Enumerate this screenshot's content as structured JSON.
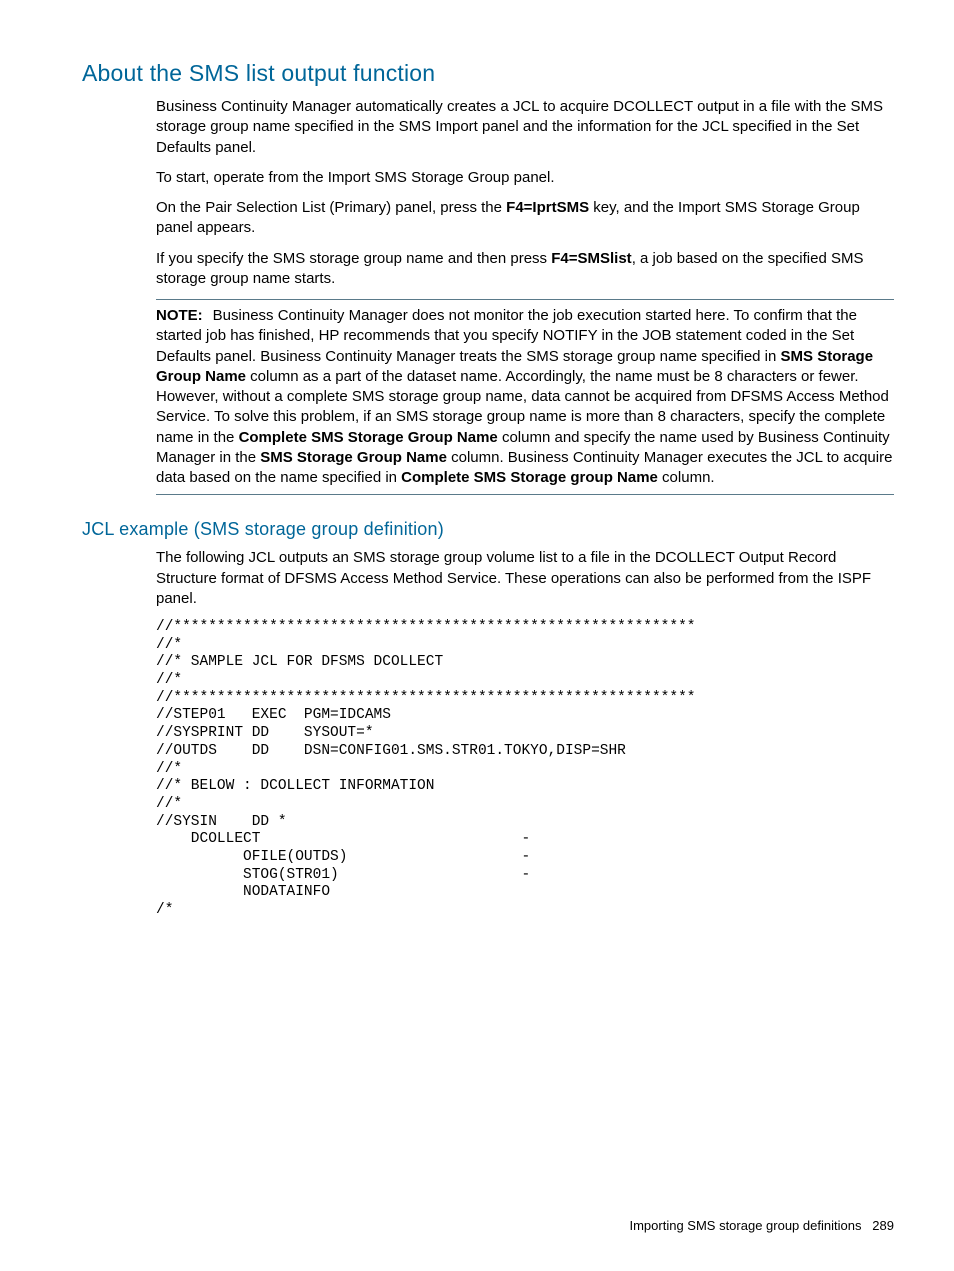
{
  "section1": {
    "heading": "About the SMS list output function",
    "p1": "Business Continuity Manager automatically creates a JCL to acquire DCOLLECT output in a file with the SMS storage group name specified in the SMS Import panel and the information for the JCL specified in the Set Defaults panel.",
    "p2": "To start, operate from the Import SMS Storage Group panel.",
    "p3_a": "On the Pair Selection List (Primary) panel, press the ",
    "p3_kw": "F4=IprtSMS",
    "p3_b": " key, and the Import SMS Storage Group panel appears.",
    "p4_a": "If you specify the SMS storage group name and then press ",
    "p4_kw": "F4=SMSlist",
    "p4_b": ", a job based on the specified SMS storage group name starts.",
    "note_label": "NOTE:",
    "note_a": "Business Continuity Manager does not monitor the job execution started here. To confirm that the started job has finished, HP recommends that you specify NOTIFY in the JOB statement coded in the Set Defaults panel. Business Continuity Manager treats the SMS storage group name specified in ",
    "note_kw1": "SMS Storage Group Name",
    "note_b": " column as a part of the dataset name. Accordingly, the name must be 8 characters or fewer. However, without a complete SMS storage group name, data cannot be acquired from DFSMS Access Method Service. To solve this problem, if an SMS storage group name is more than 8 characters, specify the complete name in the ",
    "note_kw2": "Complete SMS Storage Group Name",
    "note_c": " column and specify the name used by Business Continuity Manager in the ",
    "note_kw3": "SMS Storage Group Name",
    "note_d": " column. Business Continuity Manager executes the JCL to acquire data based on the name specified in ",
    "note_kw4": "Complete SMS Storage group Name",
    "note_e": " column."
  },
  "section2": {
    "heading": "JCL example (SMS storage group definition)",
    "p1": "The following JCL outputs an SMS storage group volume list to a file in the DCOLLECT Output Record Structure format of DFSMS Access Method Service. These operations can also be performed from the ISPF panel.",
    "code": "//************************************************************\n//*\n//* SAMPLE JCL FOR DFSMS DCOLLECT\n//*\n//************************************************************\n//STEP01   EXEC  PGM=IDCAMS\n//SYSPRINT DD    SYSOUT=*\n//OUTDS    DD    DSN=CONFIG01.SMS.STR01.TOKYO,DISP=SHR\n//*\n//* BELOW : DCOLLECT INFORMATION\n//*\n//SYSIN    DD *\n    DCOLLECT                              -\n          OFILE(OUTDS)                    -\n          STOG(STR01)                     -\n          NODATAINFO\n/*"
  },
  "footer": {
    "text": "Importing SMS storage group definitions",
    "page": "289"
  }
}
